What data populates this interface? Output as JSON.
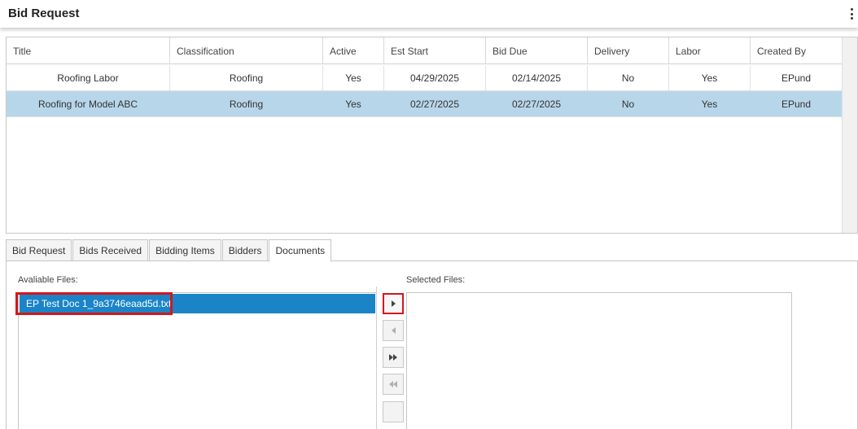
{
  "header": {
    "title": "Bid Request"
  },
  "grid": {
    "columns": [
      "Title",
      "Classification",
      "Active",
      "Est Start",
      "Bid Due",
      "Delivery",
      "Labor",
      "Created By"
    ],
    "rows": [
      {
        "title": "Roofing Labor",
        "classification": "Roofing",
        "active": "Yes",
        "est_start": "04/29/2025",
        "bid_due": "02/14/2025",
        "delivery": "No",
        "labor": "Yes",
        "created_by": "EPund",
        "selected": false
      },
      {
        "title": "Roofing for Model ABC",
        "classification": "Roofing",
        "active": "Yes",
        "est_start": "02/27/2025",
        "bid_due": "02/27/2025",
        "delivery": "No",
        "labor": "Yes",
        "created_by": "EPund",
        "selected": true
      }
    ]
  },
  "tabs": [
    {
      "label": "Bid Request",
      "active": false
    },
    {
      "label": "Bids Received",
      "active": false
    },
    {
      "label": "Bidding Items",
      "active": false
    },
    {
      "label": "Bidders",
      "active": false
    },
    {
      "label": "Documents",
      "active": true
    }
  ],
  "documents": {
    "available_label": "Avaliable Files:",
    "selected_label": "Selected Files:",
    "available_files": [
      "EP Test Doc 1_9a3746eaad5d.txt"
    ],
    "selected_files": [],
    "transfer_buttons": {
      "move_right_icon": "triangle-right-icon",
      "move_left_icon": "triangle-left-icon",
      "move_all_right_icon": "double-triangle-right-icon",
      "move_all_left_icon": "double-triangle-left-icon"
    }
  },
  "colors": {
    "selected_row": "#b8d6ea",
    "selected_item": "#1b84c7",
    "highlight": "#d4161c"
  }
}
